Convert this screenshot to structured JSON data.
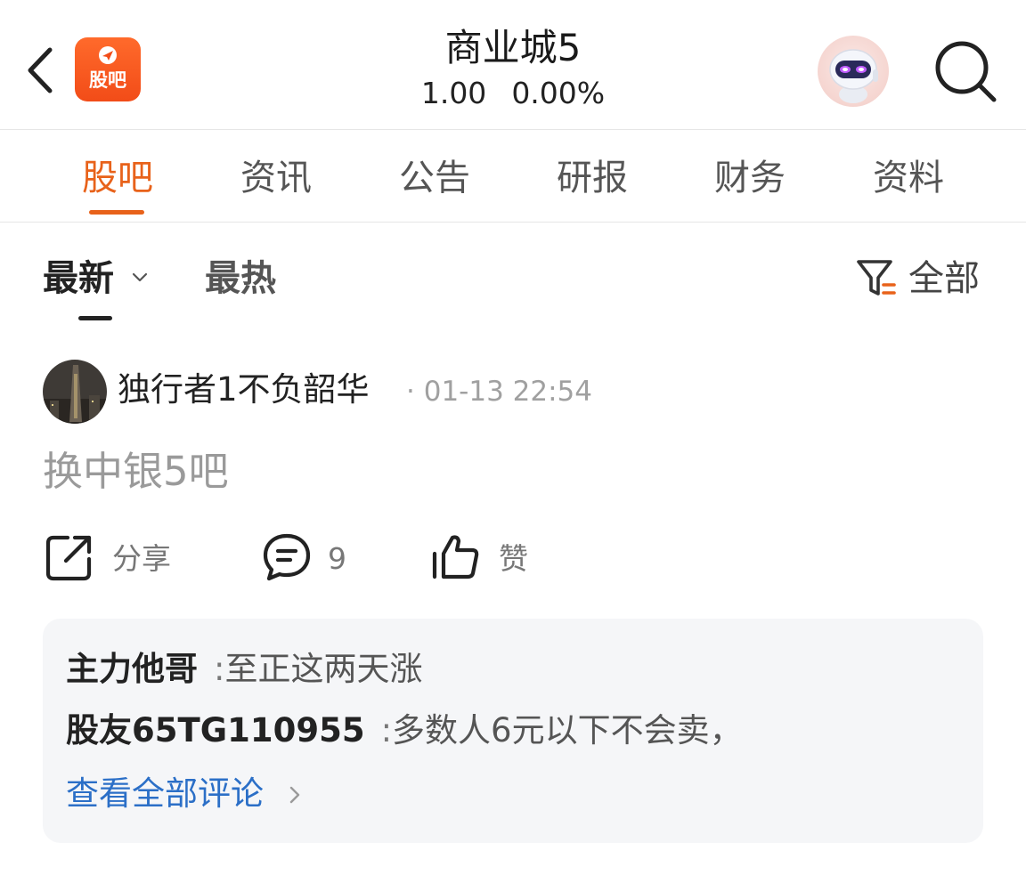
{
  "header": {
    "logo_text": "股吧",
    "title": "商业城5",
    "price": "1.00",
    "change_pct": "0.00%",
    "back_icon": "chevron-left-icon",
    "search_icon": "search-icon",
    "assistant_icon": "robot-assistant-icon"
  },
  "tabs": [
    {
      "label": "股吧",
      "active": true
    },
    {
      "label": "资讯",
      "active": false
    },
    {
      "label": "公告",
      "active": false
    },
    {
      "label": "研报",
      "active": false
    },
    {
      "label": "财务",
      "active": false
    },
    {
      "label": "资料",
      "active": false
    }
  ],
  "sort": {
    "latest_label": "最新",
    "hot_label": "最热",
    "filter_label": "全部"
  },
  "post": {
    "username": "独行者1不负韶华",
    "timestamp": "01-13 22:54",
    "content": "换中银5吧",
    "share_label": "分享",
    "comment_count": "9",
    "like_label": "赞"
  },
  "comments": {
    "items": [
      {
        "name": "主力他哥",
        "text": "至正这两天涨"
      },
      {
        "name": "股友65TG110955",
        "text": "多数人6元以下不会卖，"
      }
    ],
    "view_all_label": "查看全部评论"
  },
  "colors": {
    "accent": "#e8621a",
    "link": "#2b6fc7",
    "card_bg": "#f5f6f8"
  }
}
